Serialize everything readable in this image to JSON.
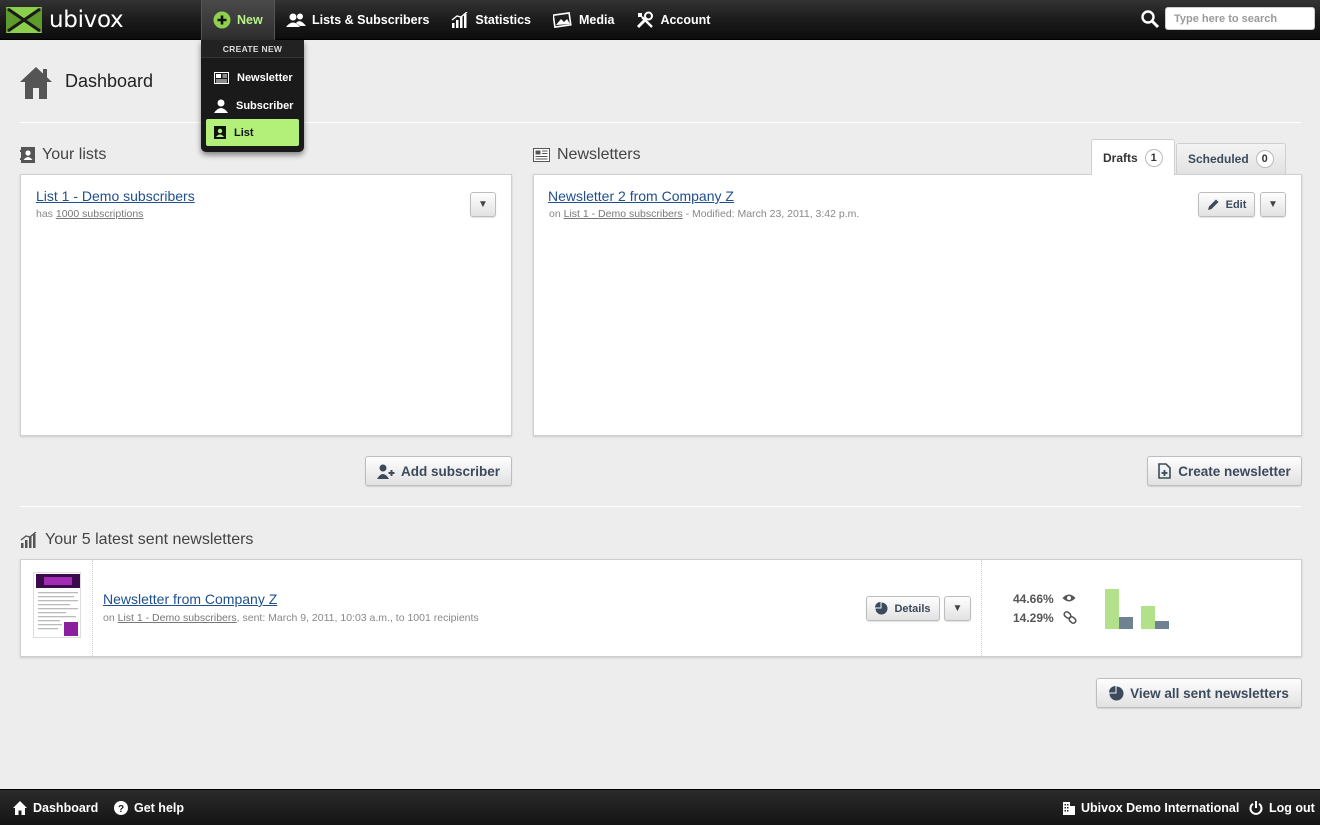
{
  "brand": {
    "name": "ubivox",
    "accent": "#b2f07a"
  },
  "nav": {
    "new": "New",
    "lists": "Lists & Subscribers",
    "statistics": "Statistics",
    "media": "Media",
    "account": "Account"
  },
  "search": {
    "placeholder": "Type here to search"
  },
  "dropdown": {
    "header": "CREATE NEW",
    "items": [
      "Newsletter",
      "Subscriber",
      "List"
    ],
    "active": "List"
  },
  "page": {
    "title": "Dashboard"
  },
  "lists": {
    "heading": "Your lists",
    "items": [
      {
        "name": "List 1 - Demo subscribers",
        "prefix": "has",
        "subscriptions": "1000 subscriptions"
      }
    ],
    "add_button": "Add subscriber"
  },
  "newsletters": {
    "heading": "Newsletters",
    "tabs": [
      {
        "label": "Drafts",
        "count": "1"
      },
      {
        "label": "Scheduled",
        "count": "0"
      }
    ],
    "items": [
      {
        "title": "Newsletter 2 from Company Z",
        "on": "on",
        "list": "List 1 - Demo subscribers",
        "modified": " - Modified: March 23, 2011, 3:42 p.m."
      }
    ],
    "edit_button": "Edit",
    "create_button": "Create newsletter"
  },
  "sent": {
    "heading": "Your 5 latest sent newsletters",
    "items": [
      {
        "title": "Newsletter from Company Z",
        "on": "on",
        "list": "List 1 - Demo subscribers",
        "details": ", sent: March 9, 2011, 10:03 a.m., to 1001 recipients",
        "open_rate": "44.66%",
        "click_rate": "14.29%",
        "bars": [
          {
            "green": 0.95,
            "gray": 0.28
          },
          {
            "green": 0.55,
            "gray": 0.18
          }
        ]
      }
    ],
    "details_button": "Details",
    "view_all_button": "View all sent newsletters"
  },
  "footer": {
    "dashboard": "Dashboard",
    "help": "Get help",
    "account": "Ubivox Demo International",
    "logout": "Log out"
  },
  "colors": {
    "bar_green": "#b3e08a",
    "bar_gray": "#6f8291",
    "link": "#1f4f8f"
  }
}
